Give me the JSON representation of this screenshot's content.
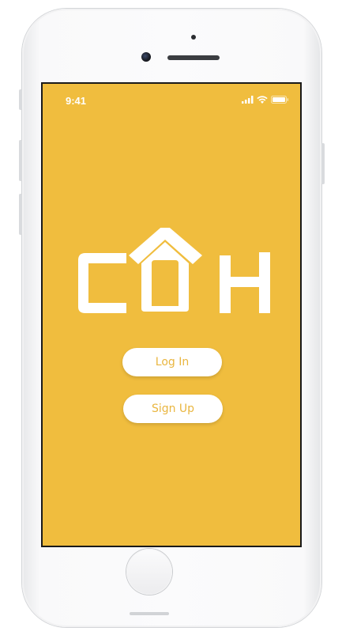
{
  "status_bar": {
    "time": "9:41"
  },
  "logo": {
    "text": "COH",
    "color": "#ffffff"
  },
  "buttons": {
    "login_label": "Log In",
    "signup_label": "Sign Up"
  },
  "colors": {
    "screen_background": "#f0bd3e",
    "button_background": "#ffffff",
    "button_text": "#e9b640"
  },
  "icons": {
    "signal": "cellular-signal-icon",
    "wifi": "wifi-icon",
    "battery": "battery-icon"
  }
}
